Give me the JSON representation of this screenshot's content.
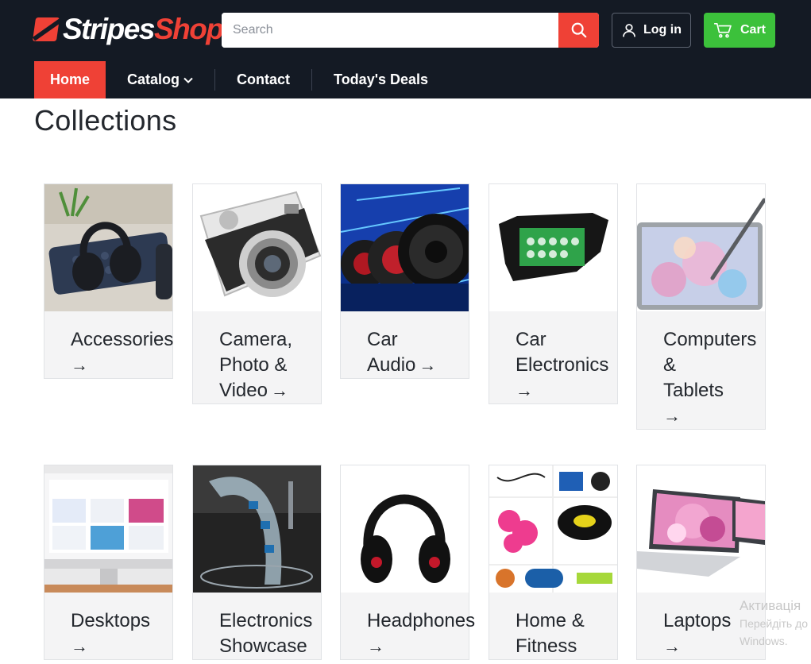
{
  "header": {
    "logo": {
      "part1": "Stripes",
      "part2": "Shop"
    },
    "search": {
      "placeholder": "Search"
    },
    "login_label": "Log in",
    "cart_label": "Cart"
  },
  "nav": {
    "home": "Home",
    "catalog": "Catalog",
    "contact": "Contact",
    "deals": "Today's Deals"
  },
  "page": {
    "title": "Collections"
  },
  "collections": [
    {
      "line1": "Accessories",
      "line2": "",
      "line3": "",
      "line4": ""
    },
    {
      "line1": "Camera,",
      "line2": "Photo &",
      "line3": "Video",
      "line4": ""
    },
    {
      "line1": "Car",
      "line2": "Audio",
      "line3": "",
      "line4": ""
    },
    {
      "line1": "Car",
      "line2": "Electronics",
      "line3": "",
      "line4": ""
    },
    {
      "line1": "Computers",
      "line2": "&",
      "line3": "Tablets",
      "line4": ""
    },
    {
      "line1": "Desktops",
      "line2": "",
      "line3": "",
      "line4": ""
    },
    {
      "line1": "Electronics",
      "line2": "Showcase",
      "line3": "",
      "line4": ""
    },
    {
      "line1": "Headphones",
      "line2": "",
      "line3": "",
      "line4": ""
    },
    {
      "line1": "Home &",
      "line2": "Fitness",
      "line3": "",
      "line4": ""
    },
    {
      "line1": "Laptops",
      "line2": "",
      "line3": "",
      "line4": ""
    }
  ],
  "arrow": "→",
  "watermark": {
    "line1": "Активація",
    "line2": "Перейдіть до",
    "line3": "Windows."
  },
  "colors": {
    "brand_red": "#ef4136",
    "header_bg": "#141a24",
    "cart_green": "#3cc13b"
  }
}
